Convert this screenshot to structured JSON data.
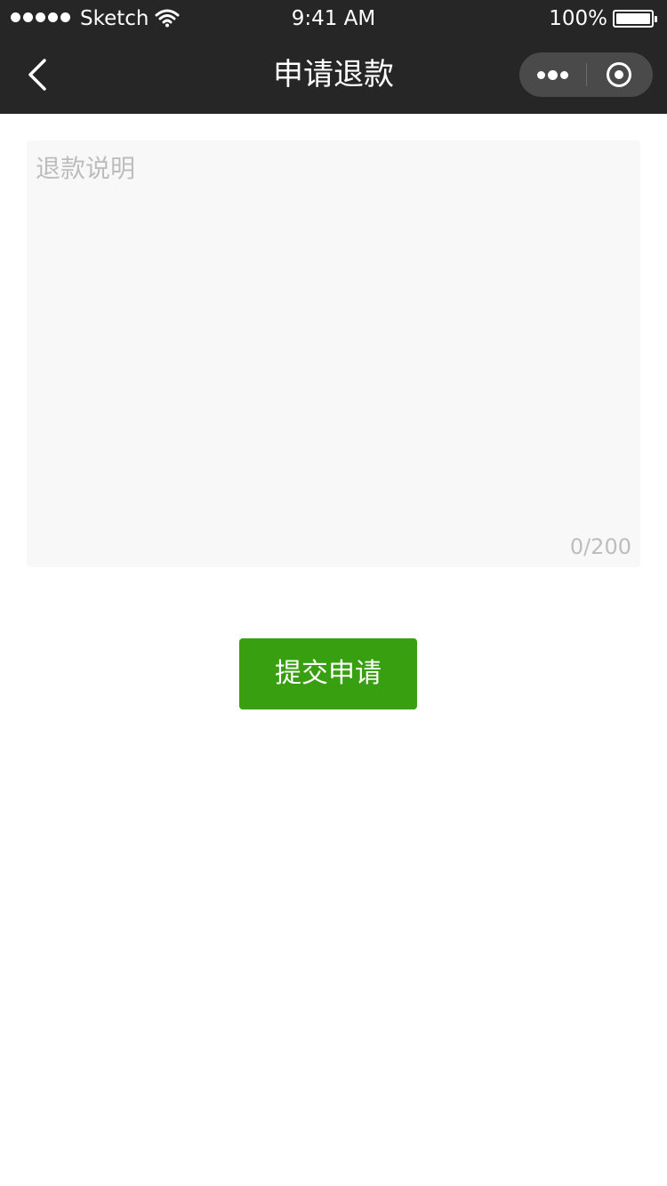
{
  "status_bar": {
    "carrier": "Sketch",
    "time": "9:41 AM",
    "battery": "100%",
    "battery_level": 1.0,
    "signal_bars": 5
  },
  "navbar": {
    "title": "申请退款",
    "back_icon": "chevron-left-icon",
    "more_icon": "more-dots-icon",
    "close_icon": "target-circle-icon"
  },
  "form": {
    "placeholder": "退款说明",
    "value": "",
    "counter": "0/200"
  },
  "submit": {
    "label": "提交申请"
  },
  "colors": {
    "header_bg": "#262626",
    "accent": "#379f10",
    "textarea_bg": "#f8f8f8",
    "placeholder": "#bdbdbd"
  }
}
